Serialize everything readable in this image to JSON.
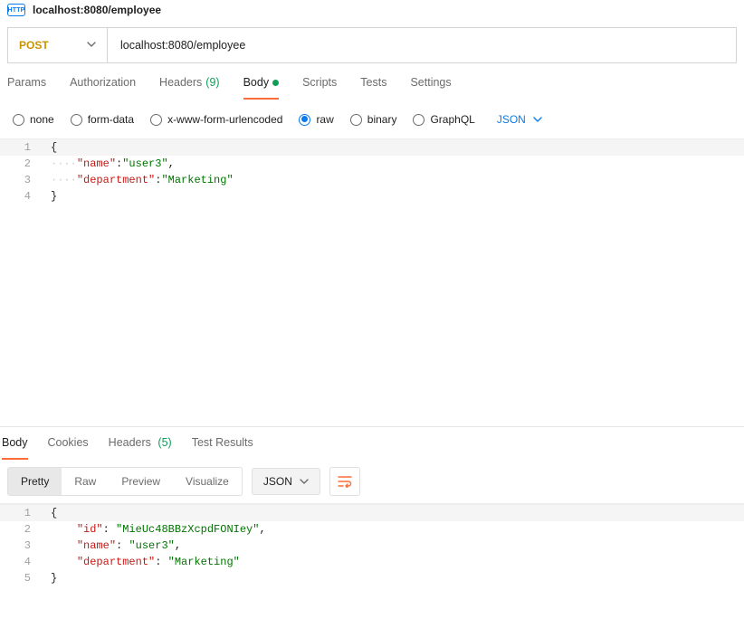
{
  "tab": {
    "title": "localhost:8080/employee"
  },
  "request": {
    "method": "POST",
    "url": "localhost:8080/employee"
  },
  "reqTabs": {
    "params": "Params",
    "auth": "Authorization",
    "headers": "Headers",
    "headersCount": "(9)",
    "body": "Body",
    "scripts": "Scripts",
    "tests": "Tests",
    "settings": "Settings"
  },
  "bodyTypes": {
    "none": "none",
    "formData": "form-data",
    "xwww": "x-www-form-urlencoded",
    "raw": "raw",
    "binary": "binary",
    "graphql": "GraphQL"
  },
  "bodyLang": "JSON",
  "requestBody": {
    "lines": [
      {
        "n": "1",
        "pre": "",
        "k": "",
        "v": "",
        "head": "{",
        "tail": ""
      },
      {
        "n": "2",
        "pre": "····",
        "k": "\"name\"",
        "v": "\"user3\"",
        "head": "",
        "tail": ","
      },
      {
        "n": "3",
        "pre": "····",
        "k": "\"department\"",
        "v": "\"Marketing\"",
        "head": "",
        "tail": ""
      },
      {
        "n": "4",
        "pre": "",
        "k": "",
        "v": "",
        "head": "}",
        "tail": ""
      }
    ]
  },
  "respTabs": {
    "body": "Body",
    "cookies": "Cookies",
    "headers": "Headers",
    "headersCount": "(5)",
    "testResults": "Test Results"
  },
  "respViews": {
    "pretty": "Pretty",
    "raw": "Raw",
    "preview": "Preview",
    "visualize": "Visualize"
  },
  "respLang": "JSON",
  "responseBody": {
    "lines": [
      {
        "n": "1",
        "pre": "",
        "k": "",
        "v": "",
        "head": "{",
        "tail": ""
      },
      {
        "n": "2",
        "pre": "    ",
        "k": "\"id\"",
        "v": "\"MieUc48BBzXcpdFONIey\"",
        "head": "",
        "tail": ","
      },
      {
        "n": "3",
        "pre": "    ",
        "k": "\"name\"",
        "v": "\"user3\"",
        "head": "",
        "tail": ","
      },
      {
        "n": "4",
        "pre": "    ",
        "k": "\"department\"",
        "v": "\"Marketing\"",
        "head": "",
        "tail": ""
      },
      {
        "n": "5",
        "pre": "",
        "k": "",
        "v": "",
        "head": "}",
        "tail": ""
      }
    ]
  }
}
